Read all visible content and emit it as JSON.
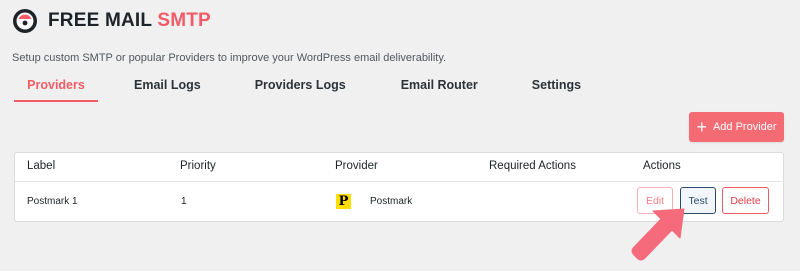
{
  "header": {
    "title_main": "FREE MAIL",
    "title_accent": "SMTP",
    "subtitle": "Setup custom SMTP or popular Providers to improve your WordPress email deliverability."
  },
  "tabs": [
    {
      "label": "Providers",
      "active": true
    },
    {
      "label": "Email Logs",
      "active": false
    },
    {
      "label": "Providers Logs",
      "active": false
    },
    {
      "label": "Email Router",
      "active": false
    },
    {
      "label": "Settings",
      "active": false
    }
  ],
  "toolbar": {
    "add_provider_label": "Add Provider"
  },
  "table": {
    "columns": [
      "Label",
      "Priority",
      "Provider",
      "Required Actions",
      "Actions"
    ],
    "rows": [
      {
        "label": "Postmark 1",
        "priority": "1",
        "provider": "Postmark",
        "provider_icon": "postmark-icon",
        "required_actions": ""
      }
    ]
  },
  "row_actions": {
    "edit": "Edit",
    "test": "Test",
    "delete": "Delete"
  },
  "colors": {
    "accent": "#f35b66",
    "test_border": "#2c4a6b",
    "postmark_yellow": "#ffde00"
  }
}
